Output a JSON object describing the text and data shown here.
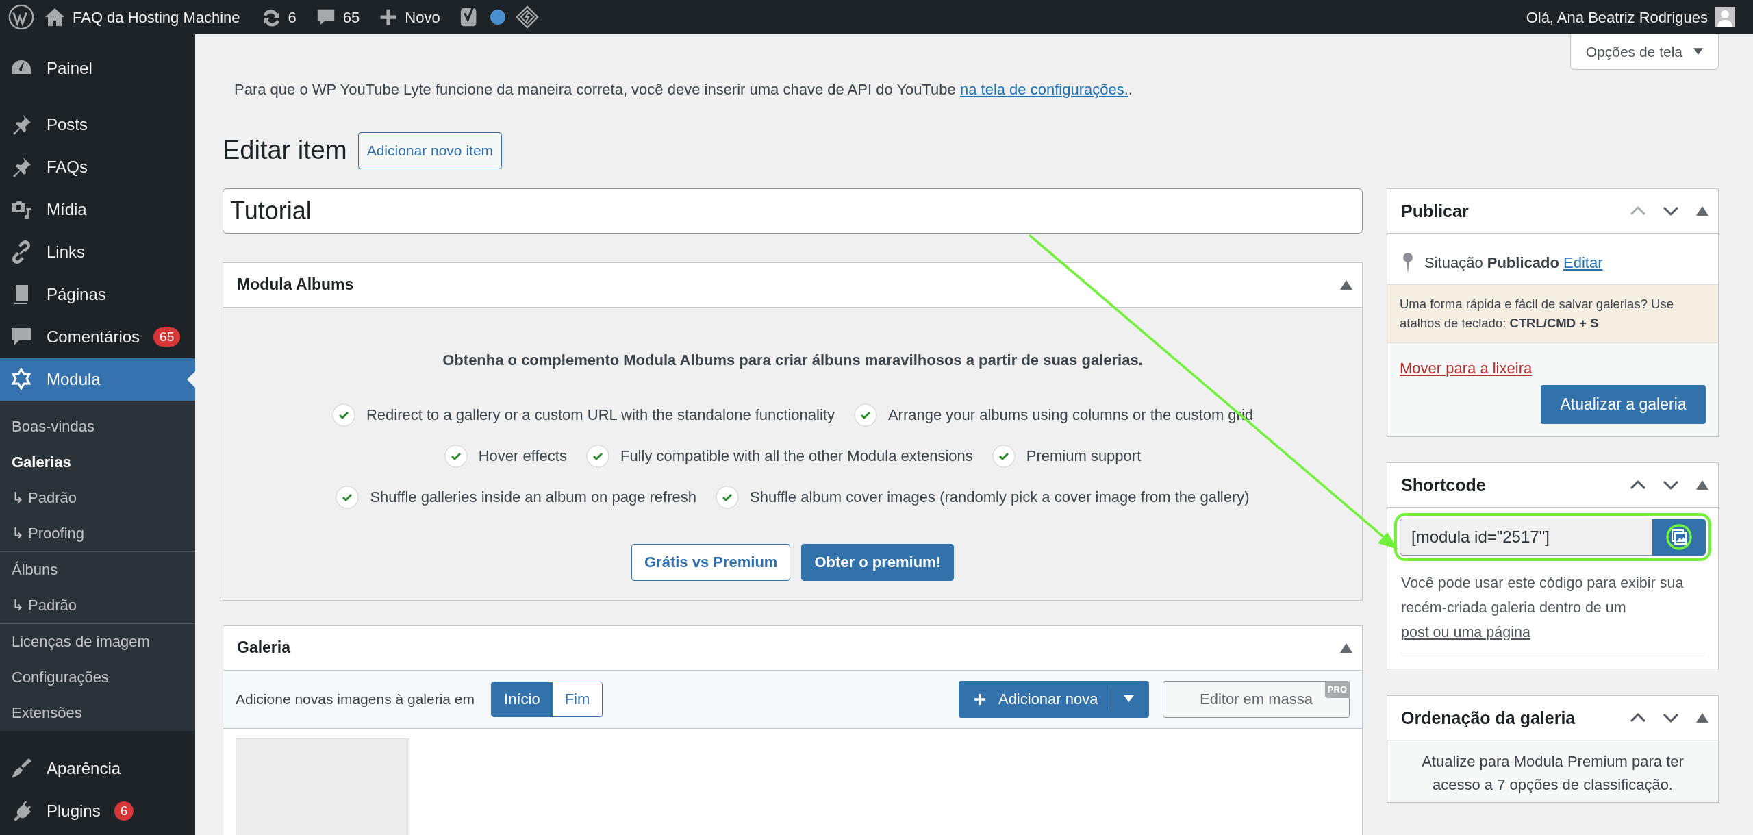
{
  "admin_bar": {
    "site_name": "FAQ da Hosting Machine",
    "updates": "6",
    "comments": "65",
    "new_label": "Novo",
    "greeting": "Olá, Ana Beatriz Rodrigues"
  },
  "sidebar": {
    "groups": [
      [
        {
          "label": "Painel",
          "selected": false
        }
      ],
      [
        {
          "label": "Posts",
          "selected": false
        },
        {
          "label": "FAQs",
          "selected": false
        },
        {
          "label": "Mídia",
          "selected": false
        },
        {
          "label": "Links",
          "selected": false
        },
        {
          "label": "Páginas",
          "selected": false
        },
        {
          "label": "Comentários",
          "badge": "65",
          "selected": false
        },
        {
          "label": "Modula",
          "selected": true,
          "children": [
            {
              "label": "Boas-vindas",
              "selected": false
            },
            {
              "label": "Galerias",
              "selected": true,
              "children": [
                {
                  "label": "↳ Padrão",
                  "selected": false
                },
                {
                  "label": "↳ Proofing",
                  "selected": false
                }
              ]
            },
            {
              "label": "Álbuns",
              "selected": false,
              "children": [
                {
                  "label": "↳ Padrão",
                  "selected": false
                }
              ]
            },
            {
              "label": "Licenças de imagem",
              "selected": false
            },
            {
              "label": "Configurações",
              "selected": false
            },
            {
              "label": "Extensões",
              "selected": false
            }
          ]
        }
      ],
      [
        {
          "label": "Aparência",
          "selected": false
        },
        {
          "label": "Plugins",
          "badge": "6",
          "selected": false
        }
      ]
    ]
  },
  "screen_options": "Opções de tela",
  "notice": {
    "text": "Para que o WP YouTube Lyte funcione da maneira correta, você deve inserir uma chave de API do YouTube",
    "link": "na tela de configurações.",
    "suffix": "."
  },
  "page_title": "Editar item",
  "add_new_button": "Adicionar novo item",
  "title_field": {
    "value": "Tutorial"
  },
  "modula_albums": {
    "title": "Modula Albums",
    "heading": "Obtenha o complemento Modula Albums para criar álbuns maravilhosos a partir de suas galerias.",
    "features": [
      [
        "Redirect to a gallery or a custom URL with the standalone functionality",
        "Arrange your albums using columns or the custom grid"
      ],
      [
        "Hover effects",
        "Fully compatible with all the other Modula extensions",
        "Premium support"
      ],
      [
        "Shuffle galleries inside an album on page refresh",
        "Shuffle album cover images (randomly pick a cover image from the gallery)"
      ]
    ],
    "buttons": [
      {
        "label": "Grátis vs Premium",
        "kind": "secondary"
      },
      {
        "label": "Obter o premium!",
        "kind": "primary"
      }
    ]
  },
  "gallery": {
    "title": "Galeria",
    "toolbar_label": "Adicione novas imagens à galeria em",
    "position_options": [
      {
        "label": "Início",
        "selected": true
      },
      {
        "label": "Fim",
        "selected": false
      }
    ],
    "add_button": "Adicionar nova",
    "bulk_editor": {
      "label": "Editor em massa",
      "badge": "PRO",
      "disabled": true
    }
  },
  "publish": {
    "title": "Publicar",
    "move_up_disabled": true,
    "status": "Situação **Publicado**",
    "edit_link": "Editar",
    "tip": "Uma forma rápida e fácil de salvar galerias? Use atalhos de teclado: **CTRL/CMD + S**",
    "trash_link": "Mover para a lixeira",
    "update_button": "Atualizar a galeria"
  },
  "shortcode": {
    "title": "Shortcode",
    "move_up_disabled": false,
    "value": "[modula id=\"2517\"]",
    "description": "Você pode usar este código para exibir sua recém-criada galeria dentro de um",
    "description_link": "post ou uma página"
  },
  "sorting": {
    "title": "Ordenação da galeria",
    "move_up_disabled": false,
    "text": "Atualize para Modula Premium para ter acesso a 7 opções de classificação."
  }
}
